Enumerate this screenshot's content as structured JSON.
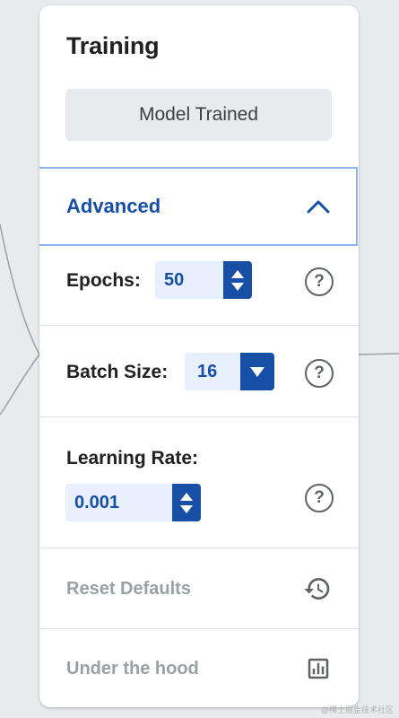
{
  "panel": {
    "title": "Training",
    "status_button": "Model Trained",
    "advanced": {
      "label": "Advanced",
      "expanded": true
    },
    "epochs": {
      "label": "Epochs:",
      "value": "50"
    },
    "batch_size": {
      "label": "Batch Size:",
      "value": "16"
    },
    "learning_rate": {
      "label": "Learning Rate:",
      "value": "0.001"
    },
    "help_glyph": "?",
    "reset_defaults": {
      "label": "Reset Defaults",
      "icon": "history-icon"
    },
    "under_the_hood": {
      "label": "Under the hood",
      "icon": "bar-chart-icon"
    }
  },
  "colors": {
    "accent": "#174ea6",
    "accent_light": "#e8f0fe",
    "focus_border": "#8ab4f8",
    "muted_text": "#9aa0a6"
  },
  "watermark": "@稀土掘金技术社区"
}
